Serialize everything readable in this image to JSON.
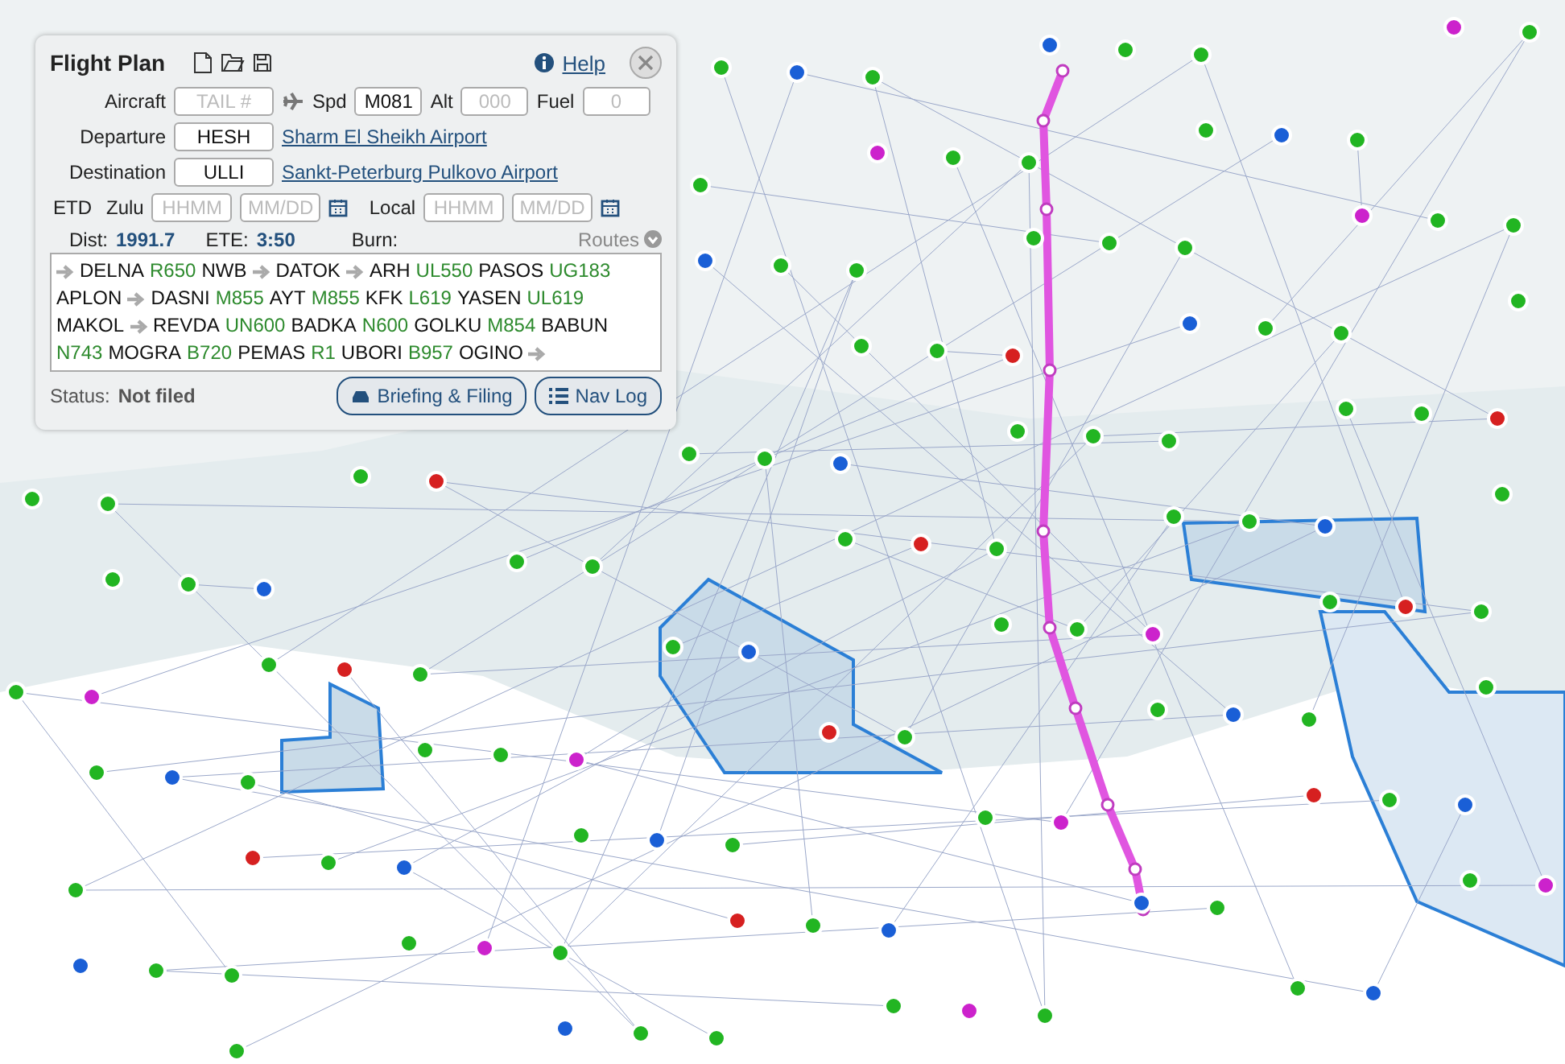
{
  "flight_plan": {
    "title": "Flight Plan",
    "help": "Help",
    "aircraft": {
      "label": "Aircraft",
      "placeholder": "TAIL #"
    },
    "speed": {
      "label": "Spd",
      "value": "M081"
    },
    "altitude": {
      "label": "Alt",
      "placeholder": "000"
    },
    "fuel": {
      "label": "Fuel",
      "placeholder": "0"
    },
    "departure": {
      "label": "Departure",
      "value": "HESH",
      "airport": "Sharm El Sheikh Airport"
    },
    "destination": {
      "label": "Destination",
      "value": "ULLI",
      "airport": "Sankt-Peterburg Pulkovo Airport"
    },
    "etd": {
      "label": "ETD",
      "zulu_label": "Zulu",
      "zulu_time_placeholder": "HHMM",
      "zulu_date_placeholder": "MM/DD",
      "local_label": "Local",
      "local_time_placeholder": "HHMM",
      "local_date_placeholder": "MM/DD"
    },
    "dist": {
      "label": "Dist:",
      "value": "1991.7"
    },
    "ete": {
      "label": "ETE:",
      "value": "3:50"
    },
    "burn": {
      "label": "Burn:"
    },
    "routes": "Routes",
    "route": [
      {
        "kind": "direct"
      },
      {
        "kind": "fix",
        "text": "DELNA"
      },
      {
        "kind": "airway",
        "text": "R650"
      },
      {
        "kind": "fix",
        "text": "NWB"
      },
      {
        "kind": "direct"
      },
      {
        "kind": "fix",
        "text": "DATOK"
      },
      {
        "kind": "direct"
      },
      {
        "kind": "fix",
        "text": "ARH"
      },
      {
        "kind": "airway",
        "text": "UL550"
      },
      {
        "kind": "fix",
        "text": "PASOS"
      },
      {
        "kind": "airway",
        "text": "UG183"
      },
      {
        "kind": "fix",
        "text": "APLON"
      },
      {
        "kind": "direct"
      },
      {
        "kind": "fix",
        "text": "DASNI"
      },
      {
        "kind": "airway",
        "text": "M855"
      },
      {
        "kind": "fix",
        "text": "AYT"
      },
      {
        "kind": "airway",
        "text": "M855"
      },
      {
        "kind": "fix",
        "text": "KFK"
      },
      {
        "kind": "airway",
        "text": "L619"
      },
      {
        "kind": "fix",
        "text": "YASEN"
      },
      {
        "kind": "airway",
        "text": "UL619"
      },
      {
        "kind": "fix",
        "text": "MAKOL"
      },
      {
        "kind": "direct"
      },
      {
        "kind": "fix",
        "text": "REVDA"
      },
      {
        "kind": "airway",
        "text": "UN600"
      },
      {
        "kind": "fix",
        "text": "BADKA"
      },
      {
        "kind": "airway",
        "text": "N600"
      },
      {
        "kind": "fix",
        "text": "GOLKU"
      },
      {
        "kind": "airway",
        "text": "M854"
      },
      {
        "kind": "fix",
        "text": "BABUN"
      },
      {
        "kind": "airway",
        "text": "N743"
      },
      {
        "kind": "fix",
        "text": "MOGRA"
      },
      {
        "kind": "airway",
        "text": "B720"
      },
      {
        "kind": "fix",
        "text": "PEMAS"
      },
      {
        "kind": "airway",
        "text": "R1"
      },
      {
        "kind": "fix",
        "text": "UBORI"
      },
      {
        "kind": "airway",
        "text": "B957"
      },
      {
        "kind": "fix",
        "text": "OGINO"
      },
      {
        "kind": "direct"
      }
    ],
    "status": {
      "label": "Status:",
      "value": "Not filed"
    },
    "buttons": [
      "Briefing & Filing",
      "Nav Log"
    ]
  }
}
